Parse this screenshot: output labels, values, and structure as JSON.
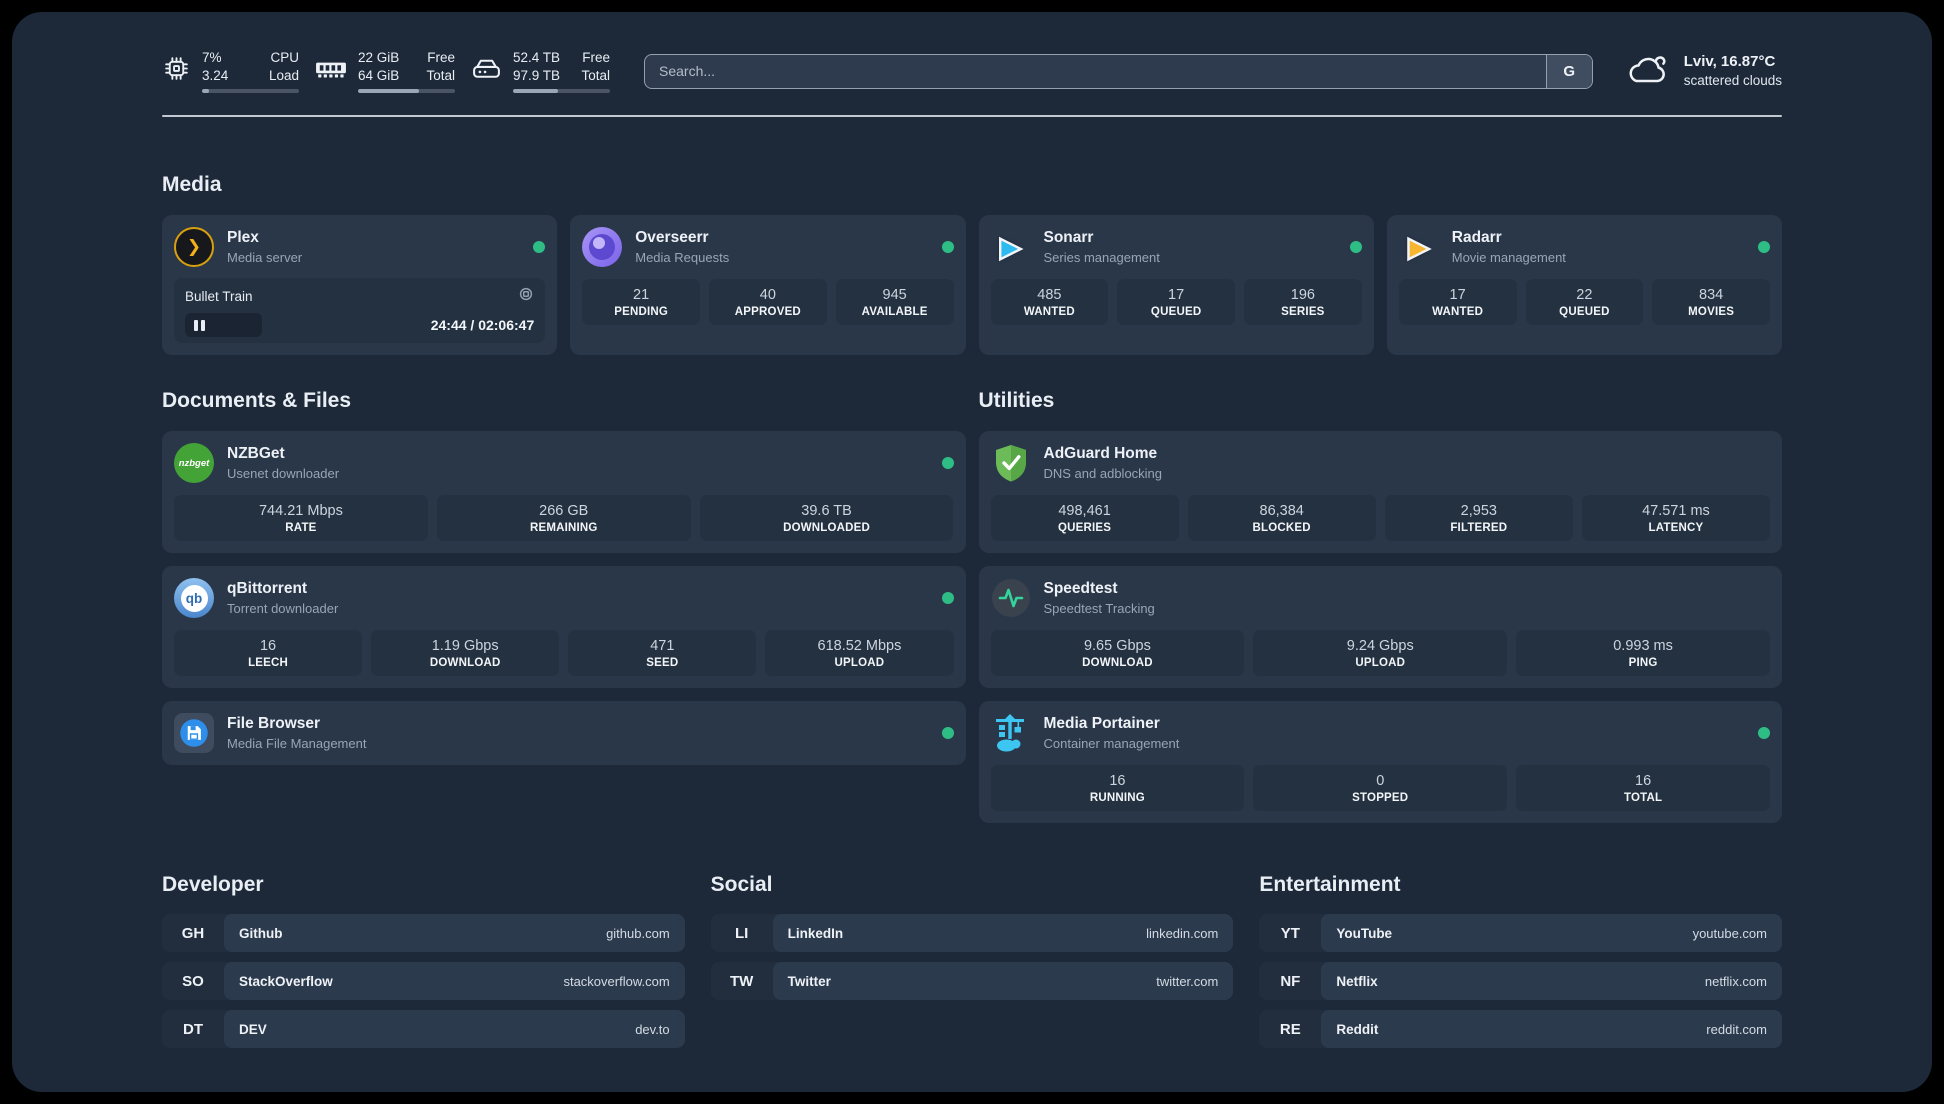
{
  "header": {
    "resources": [
      {
        "icon": "cpu-icon",
        "values": [
          "7%",
          "3.24"
        ],
        "labels": [
          "CPU",
          "Load"
        ],
        "progress_pct": 7
      },
      {
        "icon": "ram-icon",
        "values": [
          "22 GiB",
          "64 GiB"
        ],
        "labels": [
          "Free",
          "Total"
        ],
        "progress_pct": 63
      },
      {
        "icon": "disk-icon",
        "values": [
          "52.4 TB",
          "97.9 TB"
        ],
        "labels": [
          "Free",
          "Total"
        ],
        "progress_pct": 46
      }
    ],
    "search": {
      "placeholder": "Search...",
      "button": "G"
    },
    "weather": {
      "location": "Lviv, 16.87°C",
      "condition": "scattered clouds"
    }
  },
  "media": {
    "title": "Media",
    "plex": {
      "name": "Plex",
      "subtitle": "Media server",
      "player": {
        "title": "Bullet Train",
        "time": "24:44 / 02:06:47",
        "progress_pct": 22
      }
    },
    "overseerr": {
      "name": "Overseerr",
      "subtitle": "Media Requests",
      "stats": [
        {
          "value": "21",
          "label": "PENDING"
        },
        {
          "value": "40",
          "label": "APPROVED"
        },
        {
          "value": "945",
          "label": "AVAILABLE"
        }
      ]
    },
    "sonarr": {
      "name": "Sonarr",
      "subtitle": "Series management",
      "stats": [
        {
          "value": "485",
          "label": "WANTED"
        },
        {
          "value": "17",
          "label": "QUEUED"
        },
        {
          "value": "196",
          "label": "SERIES"
        }
      ]
    },
    "radarr": {
      "name": "Radarr",
      "subtitle": "Movie management",
      "stats": [
        {
          "value": "17",
          "label": "WANTED"
        },
        {
          "value": "22",
          "label": "QUEUED"
        },
        {
          "value": "834",
          "label": "MOVIES"
        }
      ]
    }
  },
  "documents": {
    "title": "Documents & Files",
    "nzbget": {
      "name": "NZBGet",
      "subtitle": "Usenet downloader",
      "icon_text": "nzbget",
      "stats": [
        {
          "value": "744.21 Mbps",
          "label": "RATE"
        },
        {
          "value": "266 GB",
          "label": "REMAINING"
        },
        {
          "value": "39.6 TB",
          "label": "DOWNLOADED"
        }
      ]
    },
    "qbittorrent": {
      "name": "qBittorrent",
      "subtitle": "Torrent downloader",
      "icon_text": "qb",
      "stats": [
        {
          "value": "16",
          "label": "LEECH"
        },
        {
          "value": "1.19 Gbps",
          "label": "DOWNLOAD"
        },
        {
          "value": "471",
          "label": "SEED"
        },
        {
          "value": "618.52 Mbps",
          "label": "UPLOAD"
        }
      ]
    },
    "filebrowser": {
      "name": "File Browser",
      "subtitle": "Media File Management"
    }
  },
  "utilities": {
    "title": "Utilities",
    "adguard": {
      "name": "AdGuard Home",
      "subtitle": "DNS and adblocking",
      "stats": [
        {
          "value": "498,461",
          "label": "QUERIES"
        },
        {
          "value": "86,384",
          "label": "BLOCKED"
        },
        {
          "value": "2,953",
          "label": "FILTERED"
        },
        {
          "value": "47.571 ms",
          "label": "LATENCY"
        }
      ]
    },
    "speedtest": {
      "name": "Speedtest",
      "subtitle": "Speedtest Tracking",
      "stats": [
        {
          "value": "9.65 Gbps",
          "label": "DOWNLOAD"
        },
        {
          "value": "9.24 Gbps",
          "label": "UPLOAD"
        },
        {
          "value": "0.993 ms",
          "label": "PING"
        }
      ]
    },
    "portainer": {
      "name": "Media Portainer",
      "subtitle": "Container management",
      "stats": [
        {
          "value": "16",
          "label": "RUNNING"
        },
        {
          "value": "0",
          "label": "STOPPED"
        },
        {
          "value": "16",
          "label": "TOTAL"
        }
      ]
    }
  },
  "bookmarks": {
    "developer": {
      "title": "Developer",
      "items": [
        {
          "abbr": "GH",
          "name": "Github",
          "url": "github.com"
        },
        {
          "abbr": "SO",
          "name": "StackOverflow",
          "url": "stackoverflow.com"
        },
        {
          "abbr": "DT",
          "name": "DEV",
          "url": "dev.to"
        }
      ]
    },
    "social": {
      "title": "Social",
      "items": [
        {
          "abbr": "LI",
          "name": "LinkedIn",
          "url": "linkedin.com"
        },
        {
          "abbr": "TW",
          "name": "Twitter",
          "url": "twitter.com"
        }
      ]
    },
    "entertainment": {
      "title": "Entertainment",
      "items": [
        {
          "abbr": "YT",
          "name": "YouTube",
          "url": "youtube.com"
        },
        {
          "abbr": "NF",
          "name": "Netflix",
          "url": "netflix.com"
        },
        {
          "abbr": "RE",
          "name": "Reddit",
          "url": "reddit.com"
        }
      ]
    }
  },
  "status": {
    "online_color": "#2ebd85"
  }
}
